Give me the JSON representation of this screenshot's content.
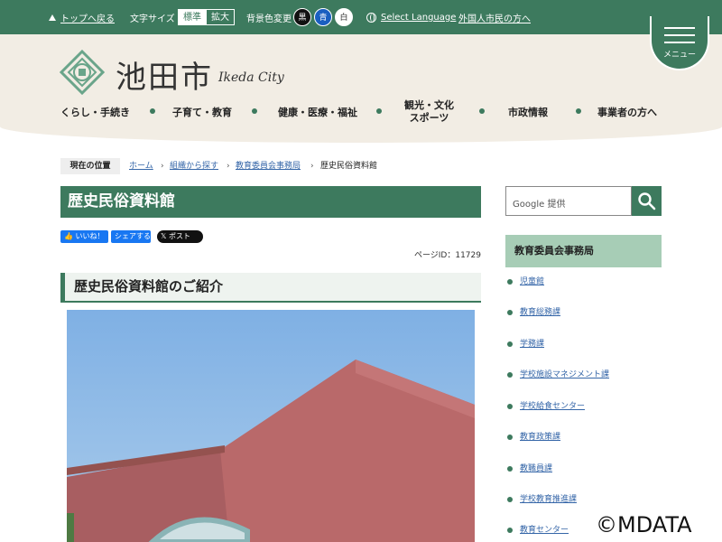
{
  "topbar": {
    "back_to_top": "トップへ戻る",
    "font_size_label": "文字サイズ",
    "font_size_standard": "標準",
    "font_size_large": "拡大",
    "bg_color_label": "背景色変更",
    "bg_black": "黒",
    "bg_blue": "青",
    "bg_white": "白",
    "select_language": "Select Language",
    "foreign_residents": "外国人市民の方へ"
  },
  "header": {
    "site_title": "池田市",
    "site_subtitle": "Ikeda City",
    "menu_label": "メニュー"
  },
  "nav": {
    "living": "くらし・手続き",
    "childcare": "子育て・教育",
    "health": "健康・医療・福祉",
    "tourism_line1": "観光・文化",
    "tourism_line2": "スポーツ",
    "city_info": "市政情報",
    "business": "事業者の方へ"
  },
  "breadcrumb": {
    "here": "現在の位置",
    "home": "ホーム",
    "by_org": "組織から探す",
    "education_office": "教育委員会事務局",
    "current": "歴史民俗資料館"
  },
  "main": {
    "page_title": "歴史民俗資料館",
    "sns_like": "いいね！",
    "sns_share": "シェアする",
    "sns_post": "ポスト",
    "page_id": "ページID：11729",
    "section_heading": "歴史民俗資料館のご紹介"
  },
  "sidebar": {
    "search_label": "Google 提供",
    "heading": "教育委員会事務局",
    "items": [
      "児童館",
      "教育総務課",
      "学務課",
      "学校施設マネジメント課",
      "学校給食センター",
      "教育政策課",
      "教職員課",
      "学校教育推進課",
      "教育センター"
    ]
  },
  "watermark": "©MDATA",
  "colors": {
    "brand_green": "#3d7a5e",
    "header_beige": "#f2ede4",
    "sidebar_heading": "#a7cdb6",
    "link_blue": "#3566a8"
  }
}
